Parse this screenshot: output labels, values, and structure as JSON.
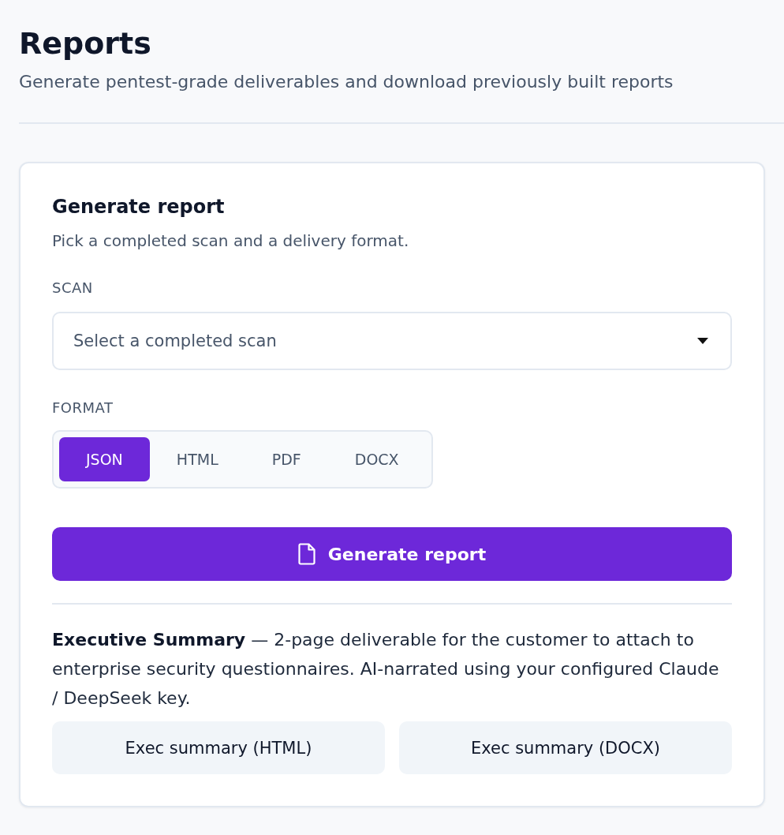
{
  "header": {
    "title": "Reports",
    "subtitle": "Generate pentest-grade deliverables and download previously built reports"
  },
  "card": {
    "title": "Generate report",
    "description": "Pick a completed scan and a delivery format.",
    "scan": {
      "label": "SCAN",
      "placeholder": "Select a completed scan"
    },
    "format": {
      "label": "FORMAT",
      "options": [
        {
          "label": "JSON",
          "selected": true
        },
        {
          "label": "HTML",
          "selected": false
        },
        {
          "label": "PDF",
          "selected": false
        },
        {
          "label": "DOCX",
          "selected": false
        }
      ]
    },
    "generate_button": {
      "label": "Generate report"
    },
    "executive_summary": {
      "text": "**Executive Summary** — 2-page deliverable for the customer to attach to enterprise security questionnaires. AI-narrated using your configured Claude / DeepSeek key.",
      "buttons": [
        {
          "label": "Exec summary (HTML)"
        },
        {
          "label": "Exec summary (DOCX)"
        }
      ]
    }
  }
}
